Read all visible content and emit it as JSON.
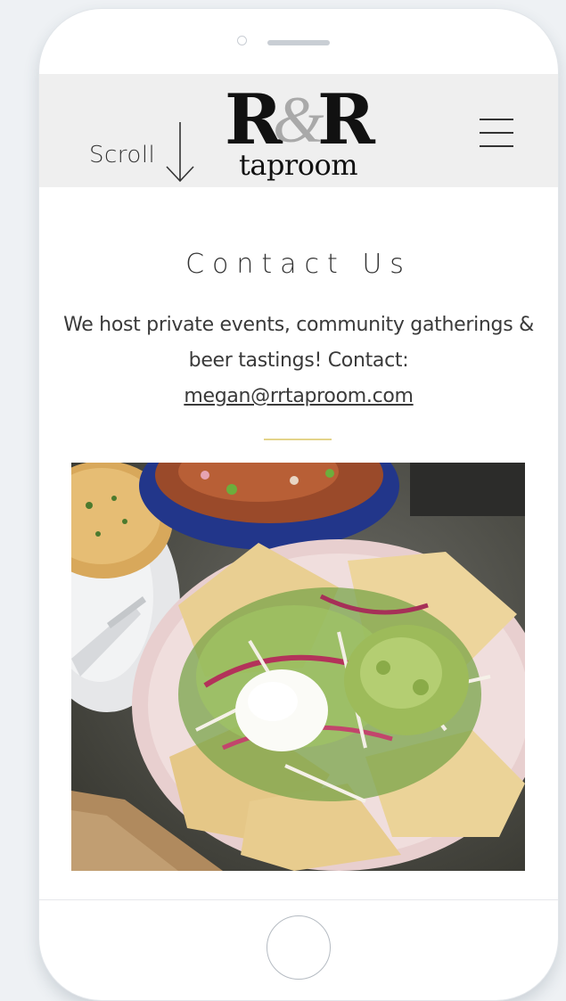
{
  "header": {
    "scroll_label": "Scroll",
    "logo": {
      "letter_left": "R",
      "ampersand": "&",
      "letter_right": "R",
      "subtitle": "taproom"
    }
  },
  "contact": {
    "title": "Contact Us",
    "body": "We host private events, community gatherings & beer tastings! Contact:",
    "email": "megan@rrtaproom.com"
  },
  "colors": {
    "header_bg": "#efefef",
    "text": "#3a3a3a",
    "accent_divider": "#e4d48a",
    "logo_ampersand": "#a9a9a9"
  },
  "icons": {
    "scroll": "arrow-down-icon",
    "menu": "hamburger-menu-icon"
  }
}
